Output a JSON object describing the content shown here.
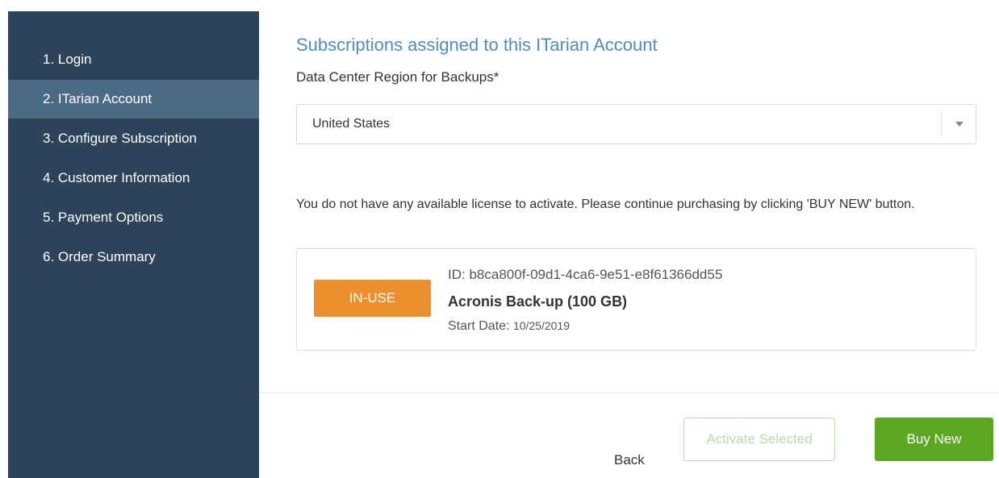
{
  "sidebar": {
    "items": [
      {
        "label": "1. Login"
      },
      {
        "label": "2. ITarian Account"
      },
      {
        "label": "3. Configure Subscription"
      },
      {
        "label": "4. Customer Information"
      },
      {
        "label": "5. Payment Options"
      },
      {
        "label": "6. Order Summary"
      }
    ],
    "active_index": 1
  },
  "main": {
    "heading": "Subscriptions assigned to this ITarian Account",
    "region_label": "Data Center Region for Backups*",
    "region_select": {
      "value": "United States",
      "icon": "chevron-down-icon"
    },
    "notice": "You do not have any available license to activate. Please continue purchasing by clicking 'BUY NEW' button.",
    "license": {
      "status": "IN-USE",
      "id_label": "ID:",
      "id_value": "b8ca800f-09d1-4ca6-9e51-e8f61366dd55",
      "name": "Acronis Back-up (100 GB)",
      "start_label": "Start Date:",
      "start_value": "10/25/2019"
    }
  },
  "footer": {
    "back_label": "Back",
    "activate_label": "Activate Selected",
    "buy_label": "Buy New"
  },
  "colors": {
    "sidebar_bg": "#2c4359",
    "sidebar_active": "#4a6a86",
    "heading": "#4f8cc1",
    "badge": "#ec8f2f",
    "primary_button": "#5aa823"
  }
}
